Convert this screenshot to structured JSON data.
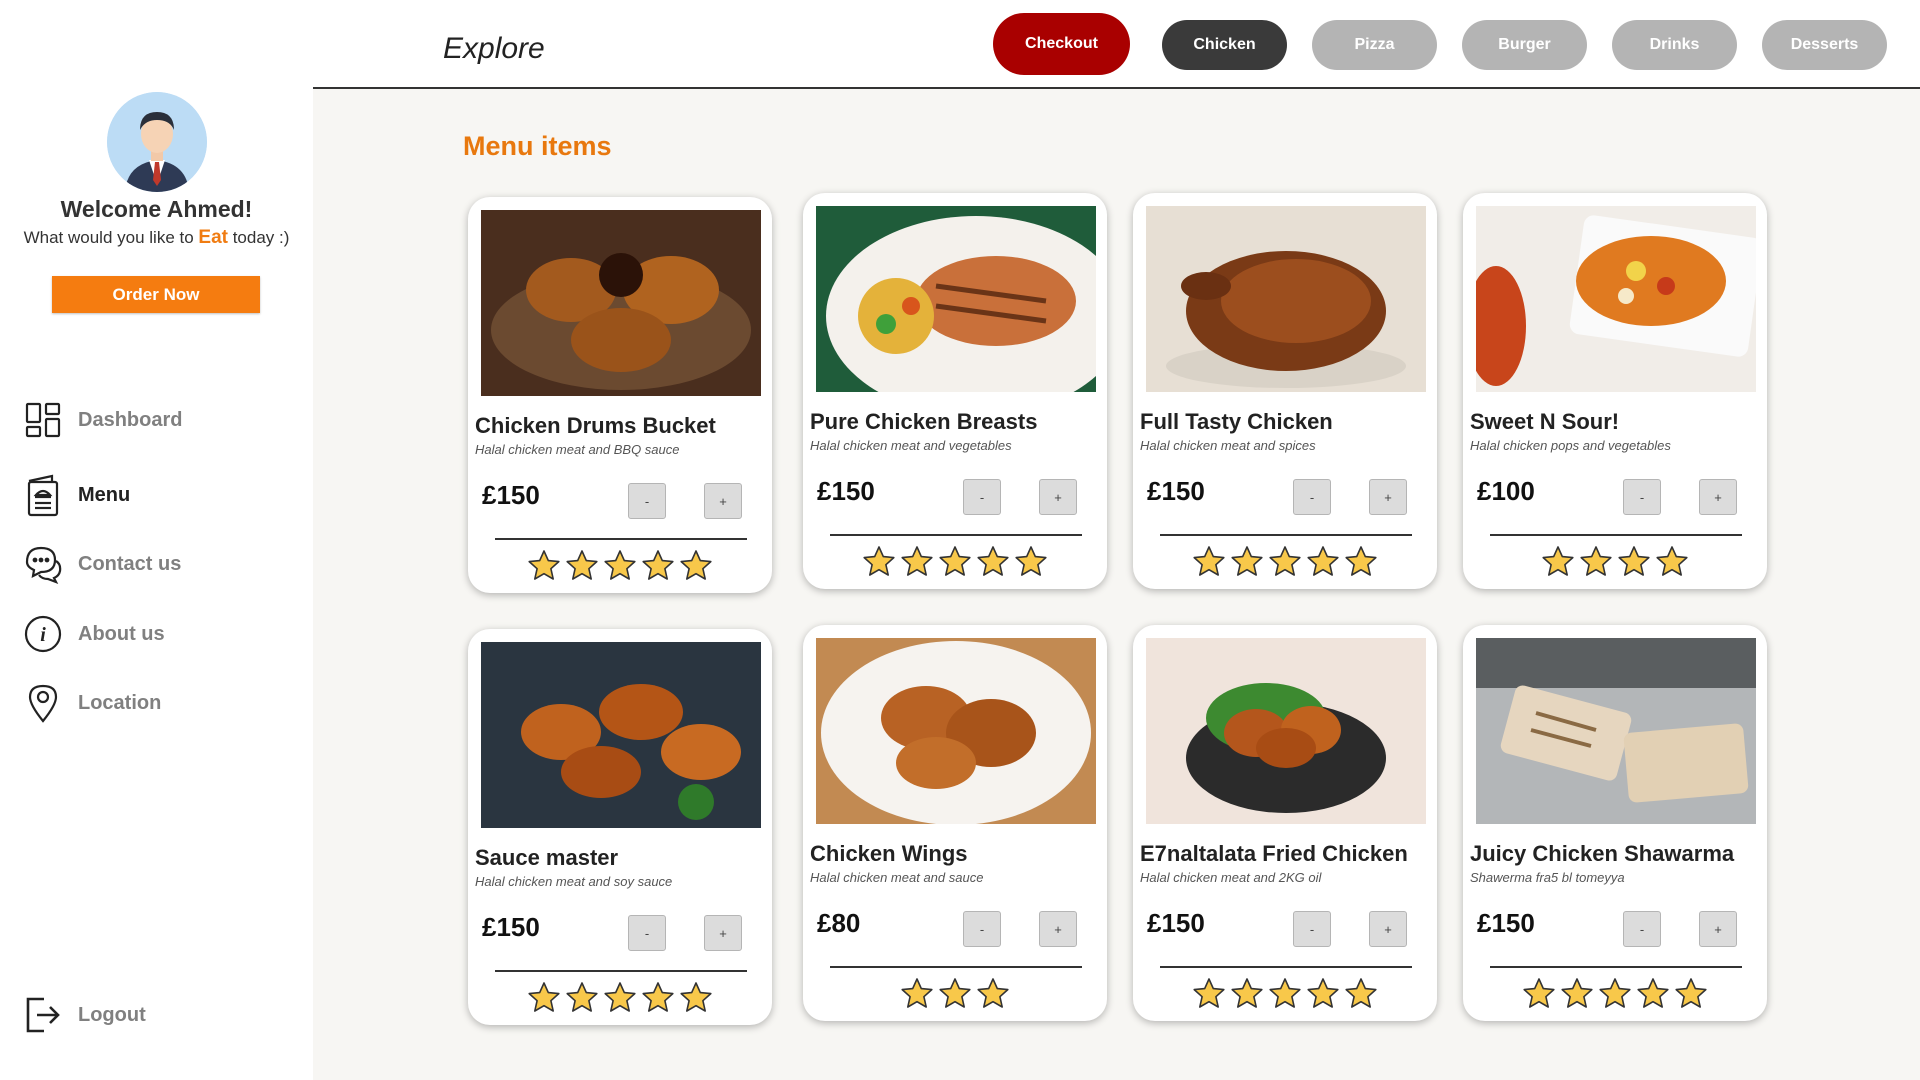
{
  "sidebar": {
    "welcome": "Welcome Ahmed!",
    "subtitle_before": "What would you like to ",
    "subtitle_highlight": "Eat",
    "subtitle_after": " today :)",
    "order_button": "Order Now",
    "nav": [
      {
        "label": "Dashboard",
        "icon": "dashboard-icon"
      },
      {
        "label": "Menu",
        "icon": "menu-book-icon",
        "active": true
      },
      {
        "label": "Contact us",
        "icon": "chat-icon"
      },
      {
        "label": "About us",
        "icon": "info-icon"
      },
      {
        "label": "Location",
        "icon": "location-pin-icon"
      }
    ],
    "logout": {
      "label": "Logout",
      "icon": "logout-icon"
    }
  },
  "header": {
    "title": "Explore",
    "checkout": "Checkout",
    "categories": [
      "Chicken",
      "Pizza",
      "Burger",
      "Drinks",
      "Desserts"
    ],
    "active_category": "Chicken"
  },
  "main": {
    "section_title": "Menu items",
    "items": [
      {
        "name": "Chicken Drums Bucket",
        "desc": "Halal chicken meat and BBQ sauce",
        "price": "£150",
        "rating": 5
      },
      {
        "name": "Pure Chicken Breasts",
        "desc": "Halal chicken meat and vegetables",
        "price": "£150",
        "rating": 5
      },
      {
        "name": "Full Tasty Chicken",
        "desc": "Halal chicken meat and spices",
        "price": "£150",
        "rating": 5
      },
      {
        "name": "Sweet N Sour!",
        "desc": "Halal chicken pops and vegetables",
        "price": "£100",
        "rating": 4
      },
      {
        "name": "Sauce master",
        "desc": "Halal chicken meat and soy sauce",
        "price": "£150",
        "rating": 5
      },
      {
        "name": "Chicken Wings",
        "desc": "Halal chicken meat and sauce",
        "price": "£80",
        "rating": 3
      },
      {
        "name": "E7naltalata Fried Chicken",
        "desc": "Halal chicken meat and 2KG oil",
        "price": "£150",
        "rating": 5
      },
      {
        "name": "Juicy Chicken Shawarma",
        "desc": "Shawerma fra5 bl tomeyya",
        "price": "£150",
        "rating": 5
      }
    ],
    "minus_label": "-",
    "plus_label": "+"
  },
  "colors": {
    "accent_orange": "#f57c10",
    "checkout_red": "#a90000",
    "active_pill": "#3a3a3a",
    "inactive_pill": "#b4b4b4",
    "star": "#f8c84a"
  }
}
